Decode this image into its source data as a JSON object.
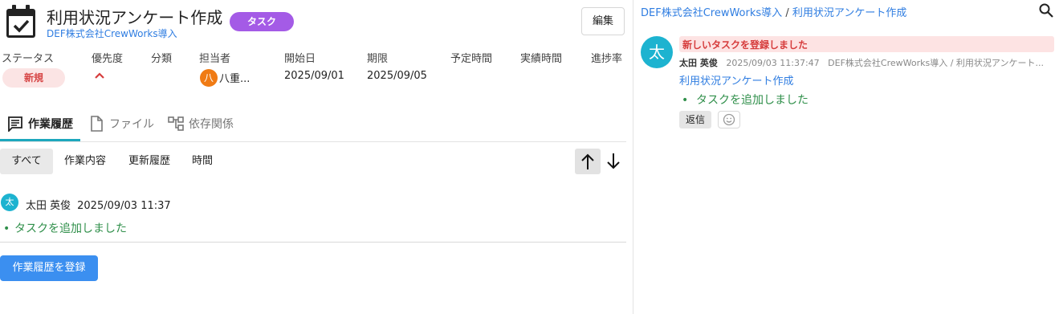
{
  "header": {
    "title": "利用状況アンケート作成",
    "badge": "タスク",
    "project": "DEF株式会社CrewWorks導入",
    "edit_label": "編集"
  },
  "fields": {
    "labels": [
      "ステータス",
      "優先度",
      "分類",
      "担当者",
      "開始日",
      "期限",
      "予定時間",
      "実績時間",
      "進捗率"
    ],
    "status": "新規",
    "priority_icon": "chevron-up-icon",
    "assignee_initial": "八",
    "assignee_name": "八重...",
    "start_date": "2025/09/01",
    "due_date": "2025/09/05"
  },
  "tabs": [
    {
      "label": "作業履歴",
      "icon": "comment-icon",
      "active": true
    },
    {
      "label": "ファイル",
      "icon": "file-icon",
      "active": false
    },
    {
      "label": "依存関係",
      "icon": "dependency-icon",
      "active": false
    }
  ],
  "filters": [
    "すべて",
    "作業内容",
    "更新履歴",
    "時間"
  ],
  "history": {
    "avatar_initial": "太",
    "author": "太田 英俊",
    "timestamp": "2025/09/03 11:37",
    "bullet": "•",
    "message": "タスクを追加しました"
  },
  "register_label": "作業履歴を登録",
  "right": {
    "breadcrumb_project": "DEF株式会社CrewWorks導入",
    "breadcrumb_sep": "/",
    "breadcrumb_task": "利用状況アンケート作成",
    "post": {
      "avatar_initial": "太",
      "highlight": "新しいタスクを登録しました",
      "author": "太田 英俊",
      "timestamp": "2025/09/03 11:37:47",
      "context": "DEF株式会社CrewWorks導入 / 利用状況アンケート...",
      "link": "利用状況アンケート作成",
      "bullet": "•",
      "message": "タスクを追加しました",
      "reply_label": "返信"
    }
  },
  "colors": {
    "badge": "#a45be6",
    "status_bg": "#fbe4e4",
    "status_text": "#d64545",
    "link": "#2f7de1",
    "accent_tab": "#1da7bd",
    "avatar": "#1db3d0",
    "assignee_avatar": "#f07b14",
    "success_text": "#2f8f4a",
    "primary_button": "#3b8ff0"
  }
}
